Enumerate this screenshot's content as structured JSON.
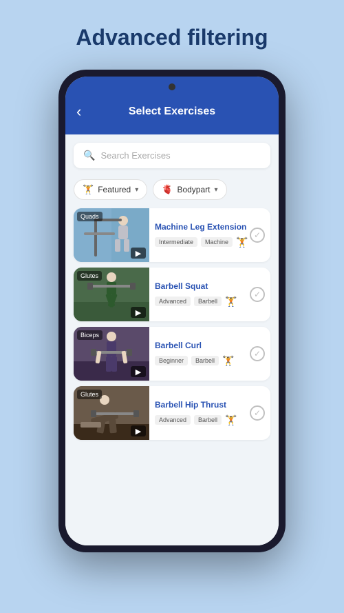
{
  "page": {
    "title": "Advanced filtering"
  },
  "header": {
    "back_label": "‹",
    "title": "Select Exercises"
  },
  "search": {
    "placeholder": "Search Exercises"
  },
  "filters": [
    {
      "id": "featured",
      "icon": "🏋",
      "label": "Featured",
      "has_dropdown": true
    },
    {
      "id": "bodypart",
      "icon": "🫀",
      "label": "Bodypart",
      "has_dropdown": true
    }
  ],
  "exercises": [
    {
      "id": "1",
      "name": "Machine Leg Extension",
      "level": "Intermediate",
      "equipment": "Machine",
      "muscle_group": "Quads",
      "thumb_class": "thumb-bg-1",
      "emoji": "🏋️"
    },
    {
      "id": "2",
      "name": "Barbell Squat",
      "level": "Advanced",
      "equipment": "Barbell",
      "muscle_group": "Glutes",
      "thumb_class": "thumb-bg-2",
      "emoji": "🏋️"
    },
    {
      "id": "3",
      "name": "Barbell Curl",
      "level": "Beginner",
      "equipment": "Barbell",
      "muscle_group": "Biceps",
      "thumb_class": "thumb-bg-3",
      "emoji": "🏋️"
    },
    {
      "id": "4",
      "name": "Barbell Hip Thrust",
      "level": "Advanced",
      "equipment": "Barbell",
      "muscle_group": "Glutes",
      "thumb_class": "thumb-bg-4",
      "emoji": "🏋️"
    }
  ],
  "icons": {
    "search": "🔍",
    "video": "▶",
    "check": "✓",
    "chevron": "▾",
    "back": "‹",
    "dumbbell": "🏋"
  }
}
